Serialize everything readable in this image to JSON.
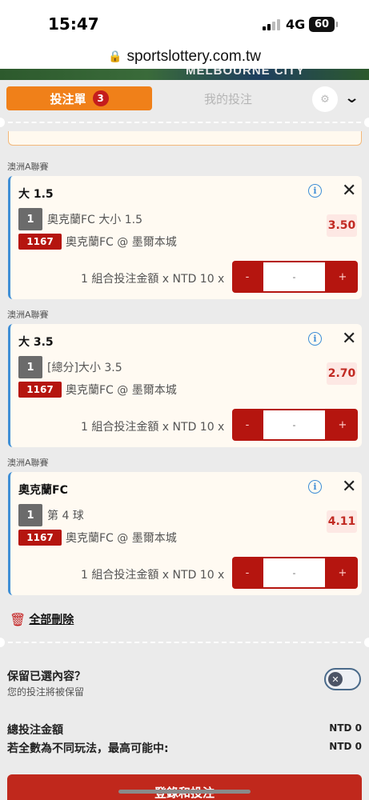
{
  "status": {
    "time": "15:47",
    "network": "4G",
    "battery": "60"
  },
  "browser": {
    "url": "sportslottery.com.tw"
  },
  "banner": {
    "text": "MELBOURNE CITY"
  },
  "tabs": {
    "betslip": "投注單",
    "betslip_count": "3",
    "my_bets": "我的投注"
  },
  "bets": [
    {
      "league": "澳洲A聯賽",
      "selection": "大 1.5",
      "leg_number": "1",
      "market": "奧克蘭FC 大小 1.5",
      "odds": "3.50",
      "match_id": "1167",
      "match": "奧克蘭FC @ 墨爾本城",
      "stake_label": "1 組合投注金額 x NTD 10 x",
      "stake_placeholder": "-",
      "minus": "-",
      "plus": "+"
    },
    {
      "league": "澳洲A聯賽",
      "selection": "大 3.5",
      "leg_number": "1",
      "market": "[總分]大小 3.5",
      "odds": "2.70",
      "match_id": "1167",
      "match": "奧克蘭FC @ 墨爾本城",
      "stake_label": "1 組合投注金額 x NTD 10 x",
      "stake_placeholder": "-",
      "minus": "-",
      "plus": "+"
    },
    {
      "league": "澳洲A聯賽",
      "selection": "奧克蘭FC",
      "leg_number": "1",
      "market": "第 4 球",
      "odds": "4.11",
      "match_id": "1167",
      "match": "奧克蘭FC @ 墨爾本城",
      "stake_label": "1 組合投注金額 x NTD 10 x",
      "stake_placeholder": "-",
      "minus": "-",
      "plus": "+"
    }
  ],
  "delete_all": "全部刪除",
  "keep": {
    "title": "保留已選內容？",
    "subtitle": "您的投注將被保留",
    "enabled": false
  },
  "totals": {
    "total_label": "總投注金額",
    "total_value": "NTD 0",
    "max_label": "若全數為不同玩法，最高可能中:",
    "max_value": "NTD 0"
  },
  "submit": {
    "label": "登錄和投注"
  },
  "colors": {
    "accent": "#f08019",
    "danger": "#b5150f",
    "info": "#3f8fd6"
  }
}
